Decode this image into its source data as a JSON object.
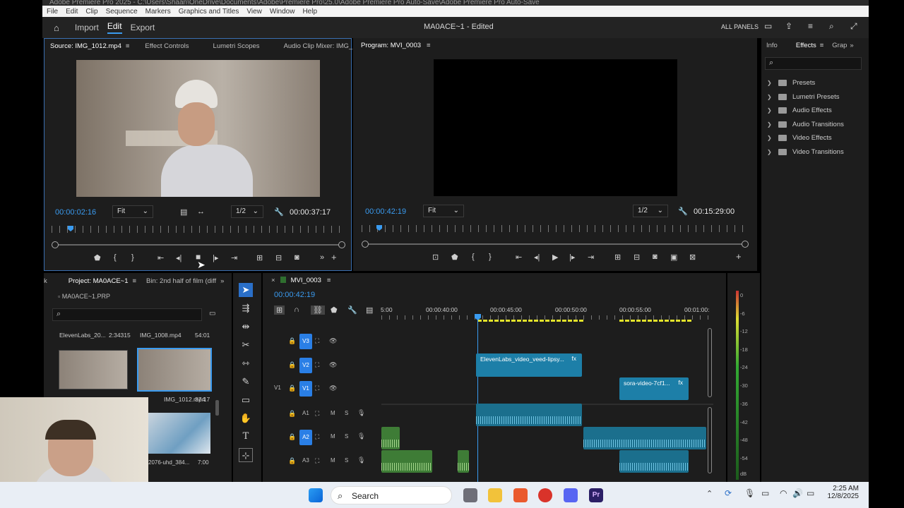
{
  "titlebar": {
    "text": "Adobe Premiere Pro 2025 - C:\\Users\\Shaan\\OneDrive\\Documents\\Adobe\\Premiere Pro\\25.0\\Adobe Premiere Pro Auto-Save\\Adobe Premiere Pro Auto-Save"
  },
  "menu": [
    "File",
    "Edit",
    "Clip",
    "Sequence",
    "Markers",
    "Graphics and Titles",
    "View",
    "Window",
    "Help"
  ],
  "header": {
    "import": "Import",
    "edit": "Edit",
    "export": "Export",
    "doc_title": "MA0ACE~1",
    "doc_status": "- Edited",
    "all_panels": "ALL PANELS"
  },
  "source": {
    "tabs": [
      "Source: IMG_1012.mp4",
      "Effect Controls",
      "Lumetri Scopes",
      "Audio Clip Mixer: IMG_1"
    ],
    "timecode": "00:00:02:16",
    "fit": "Fit",
    "res": "1/2",
    "duration": "00:00:37:17"
  },
  "program": {
    "tab": "Program: MVI_0003",
    "timecode": "00:00:42:19",
    "fit": "Fit",
    "res": "1/2",
    "duration": "00:15:29:00"
  },
  "effects": {
    "tabs": [
      "Info",
      "Effects",
      "Grap"
    ],
    "items": [
      "Presets",
      "Lumetri Presets",
      "Audio Effects",
      "Audio Transitions",
      "Video Effects",
      "Video Transitions"
    ]
  },
  "project": {
    "tabs": [
      "k",
      "Project: MA0ACE~1",
      "Bin: 2nd half of film (diff"
    ],
    "file": "MA0ACE~1.PRP",
    "items": [
      {
        "name": "ElevenLabs_20...",
        "dur": "2:34315"
      },
      {
        "name": "IMG_1008.mp4",
        "dur": "54:01"
      },
      {
        "name": "IMG_1012.mp4",
        "dur": "37:17"
      },
      {
        "name": "2076-uhd_384...",
        "dur": "7:00"
      }
    ]
  },
  "timeline": {
    "tab": "MVI_0003",
    "timecode": "00:00:42:19",
    "ruler": [
      "5:00",
      "00:00:40:00",
      "00:00:45:00",
      "00:00:50:00",
      "00:00:55:00",
      "00:01:00:"
    ],
    "tracks": [
      {
        "id": "V3",
        "target": ""
      },
      {
        "id": "V2",
        "target": ""
      },
      {
        "id": "V1",
        "target": "V1"
      },
      {
        "id": "A1",
        "target": ""
      },
      {
        "id": "A2",
        "target": ""
      },
      {
        "id": "A3",
        "target": ""
      }
    ],
    "clips": {
      "v2": "ElevenLabs_video_veed-lipsy...",
      "v1": "sora-video-7cf1...",
      "fx": "fx"
    }
  },
  "meter": [
    "0",
    "-6",
    "-12",
    "-18",
    "-24",
    "-30",
    "-36",
    "-42",
    "-48",
    "-54",
    "dB"
  ],
  "taskbar": {
    "search": "Search",
    "time": "2:25 AM",
    "date": "12/8/2025"
  },
  "colors": {
    "accent": "#3a9bf0",
    "timeline_in_out": "#e3e32b",
    "clip_video": "#1d7fa8",
    "clip_audio_green": "#3e7c36"
  }
}
